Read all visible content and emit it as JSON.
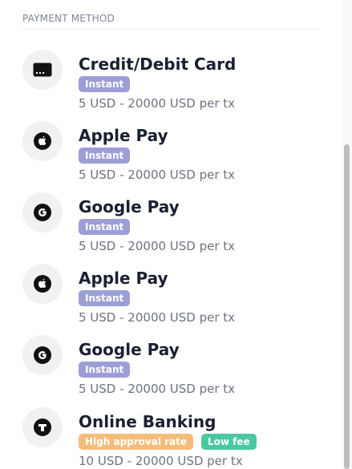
{
  "section": {
    "title": "PAYMENT METHOD"
  },
  "methods": [
    {
      "title": "Credit/Debit Card",
      "icon": "credit-card-icon",
      "badges": [
        {
          "label": "Instant",
          "color": "#9d9ed6"
        }
      ],
      "range": "5 USD - 20000 USD per tx"
    },
    {
      "title": "Apple Pay",
      "icon": "apple-icon",
      "badges": [
        {
          "label": "Instant",
          "color": "#9d9ed6"
        }
      ],
      "range": "5 USD - 20000 USD per tx"
    },
    {
      "title": "Google Pay",
      "icon": "google-icon",
      "badges": [
        {
          "label": "Instant",
          "color": "#9d9ed6"
        }
      ],
      "range": "5 USD - 20000 USD per tx"
    },
    {
      "title": "Apple Pay",
      "icon": "apple-icon",
      "badges": [
        {
          "label": "Instant",
          "color": "#9d9ed6"
        }
      ],
      "range": "5 USD - 20000 USD per tx"
    },
    {
      "title": "Google Pay",
      "icon": "google-icon",
      "badges": [
        {
          "label": "Instant",
          "color": "#9d9ed6"
        }
      ],
      "range": "5 USD - 20000 USD per tx"
    },
    {
      "title": "Online Banking",
      "icon": "online-banking-icon",
      "badges": [
        {
          "label": "High approval rate",
          "color": "#f5bd79"
        },
        {
          "label": "Low fee",
          "color": "#48c9a1"
        }
      ],
      "range": "10 USD - 20000 USD per tx"
    }
  ]
}
